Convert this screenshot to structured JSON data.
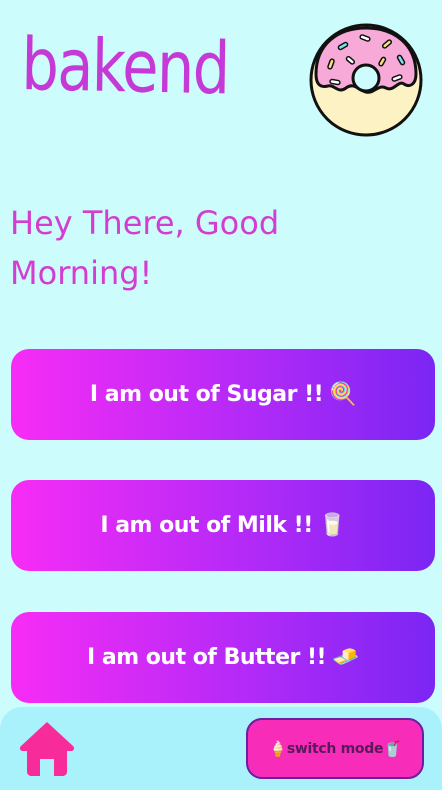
{
  "header": {
    "logo_text": "bakend",
    "donut_icon": "donut-icon"
  },
  "greeting": {
    "text": "Hey There, Good Morning!"
  },
  "actions": [
    {
      "label": "I am out of Sugar !!",
      "emoji": "🍭"
    },
    {
      "label": "I am out of Milk !!",
      "emoji": "🥛"
    },
    {
      "label": "I am out of Butter !!",
      "emoji": "🧈"
    }
  ],
  "bottom_bar": {
    "home_icon": "home-icon",
    "switch_label": "switch mode",
    "switch_emoji_left": "🍦",
    "switch_emoji_right": "🥤"
  },
  "colors": {
    "background": "#ccfcfb",
    "accent": "#c53ad6",
    "button_gradient_start": "#f72cf6",
    "button_gradient_end": "#7b26f4",
    "bottom_bar": "#a9f2fc",
    "switch_button": "#f72cb9"
  }
}
